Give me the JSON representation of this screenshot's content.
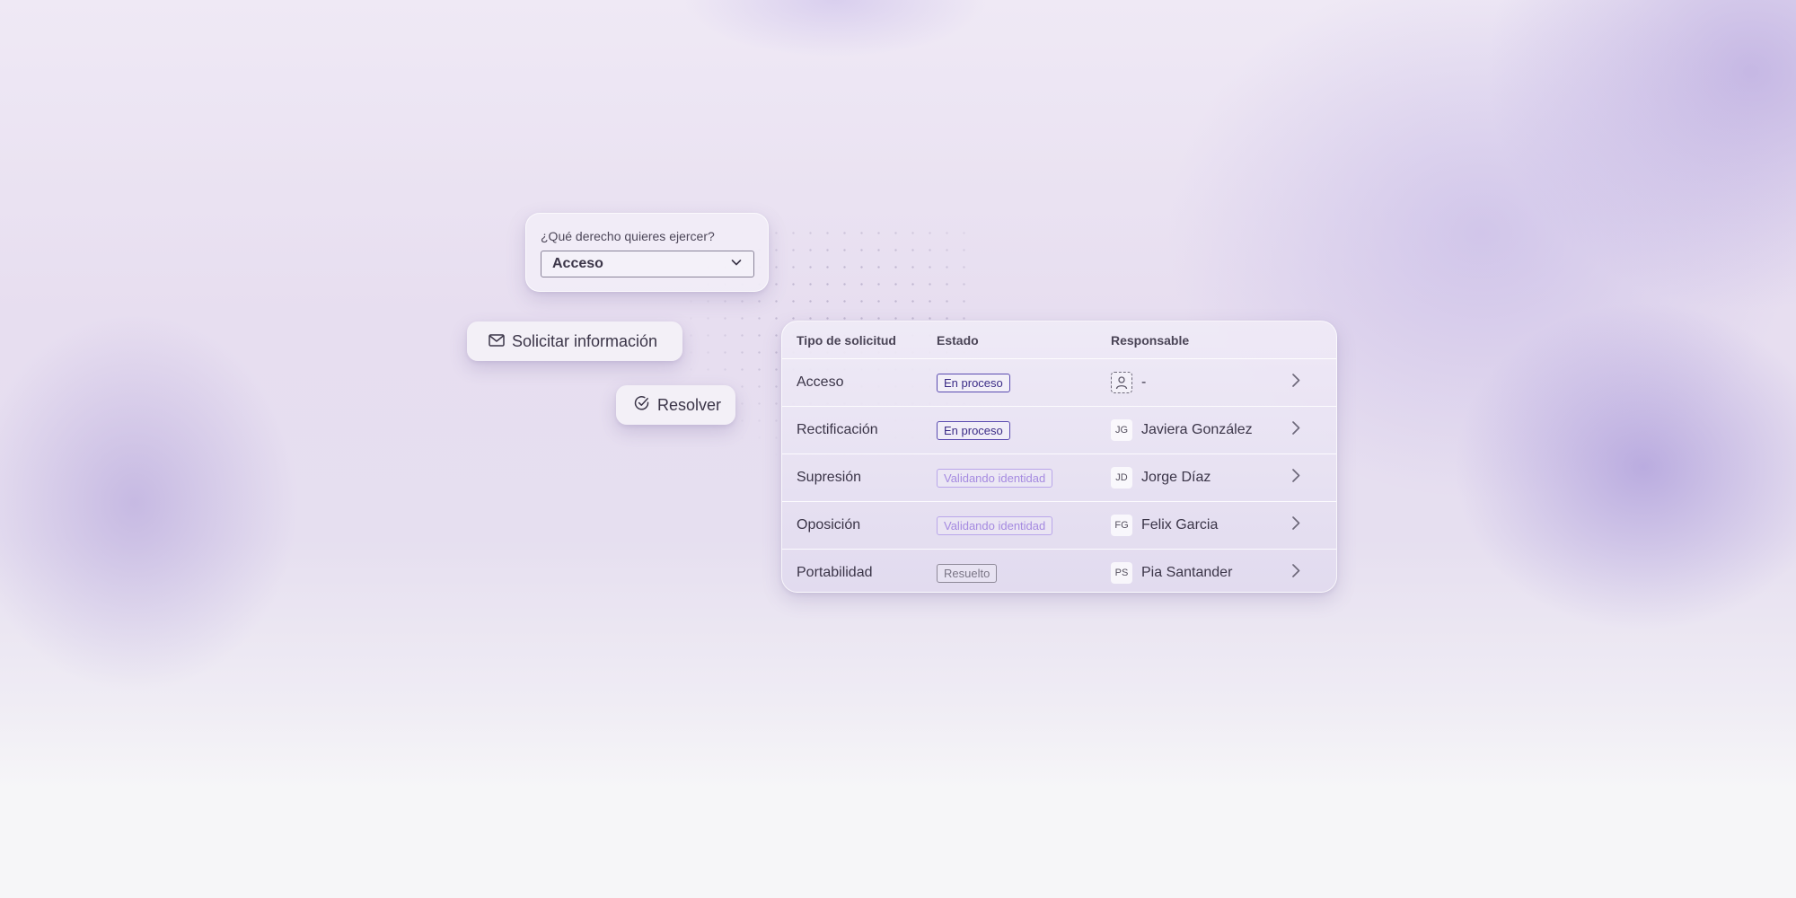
{
  "right_form": {
    "question": "¿Qué derecho quieres ejercer?",
    "selected": "Acceso"
  },
  "actions": {
    "request_info": "Solicitar información",
    "resolve": "Resolver"
  },
  "table": {
    "headers": [
      "Tipo de solicitud",
      "Estado",
      "Responsable"
    ],
    "rows": [
      {
        "type": "Acceso",
        "status": "En proceso",
        "assignee_initials": "",
        "assignee": "-"
      },
      {
        "type": "Rectificación",
        "status": "En proceso",
        "assignee_initials": "JG",
        "assignee": "Javiera González"
      },
      {
        "type": "Supresión",
        "status": "Validando identidad",
        "assignee_initials": "JD",
        "assignee": "Jorge Díaz"
      },
      {
        "type": "Oposición",
        "status": "Validando identidad",
        "assignee_initials": "FG",
        "assignee": "Felix Garcia"
      },
      {
        "type": "Portabilidad",
        "status": "Resuelto",
        "assignee_initials": "PS",
        "assignee": "Pia Santander"
      }
    ]
  },
  "colors": {
    "accent": "#5a4bb0",
    "status_in_progress": "#3b2c86",
    "status_validating": "#a58ae0",
    "status_resolved": "#7a7585"
  },
  "icons": {
    "dropdown": "chevron-down-icon",
    "request_info": "mail-icon",
    "resolve": "check-circle-icon",
    "unassigned": "user-placeholder-icon",
    "row_action": "chevron-right-icon"
  }
}
